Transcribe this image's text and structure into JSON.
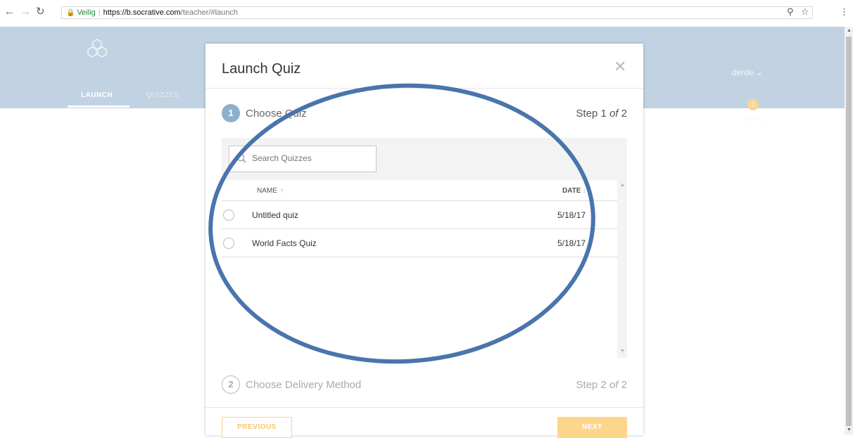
{
  "browser": {
    "secure_label": "Veilig",
    "url_host": "https://b.socrative.com",
    "url_path": "/teacher/#launch"
  },
  "header": {
    "tabs": [
      {
        "label": "LAUNCH"
      },
      {
        "label": "QUIZZES"
      }
    ],
    "user_name": "derde",
    "notification_count": "1"
  },
  "modal": {
    "title": "Launch Quiz",
    "step1": {
      "number": "1",
      "label": "Choose Quiz",
      "count_prefix": "Step 1 ",
      "count_of": "of",
      "count_suffix": " 2"
    },
    "step2": {
      "number": "2",
      "label": "Choose Delivery Method",
      "count_prefix": "Step 2 ",
      "count_of": "of",
      "count_suffix": " 2"
    },
    "search": {
      "placeholder": "Search Quizzes"
    },
    "table": {
      "col_name": "NAME",
      "col_date": "DATE",
      "rows": [
        {
          "name": "Untitled quiz",
          "date": "5/18/17"
        },
        {
          "name": "World Facts Quiz",
          "date": "5/18/17"
        }
      ]
    },
    "buttons": {
      "previous": "PREVIOUS",
      "next": "NEXT"
    }
  },
  "colors": {
    "header_bg": "#8fb0cc",
    "accent_orange": "#fdd58b",
    "annotation_blue": "#4a74ad"
  }
}
